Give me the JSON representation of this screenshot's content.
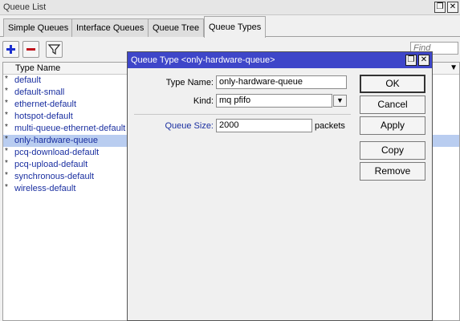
{
  "window": {
    "title": "Queue List"
  },
  "tabs": [
    {
      "label": "Simple Queues"
    },
    {
      "label": "Interface Queues"
    },
    {
      "label": "Queue Tree"
    },
    {
      "label": "Queue Types"
    }
  ],
  "toolbar": {
    "add_icon": "plus-icon",
    "remove_icon": "minus-icon",
    "filter_icon": "filter-icon",
    "find_placeholder": "Find"
  },
  "list": {
    "column_header": "Type Name",
    "rows": [
      {
        "mark": "*",
        "name": "default"
      },
      {
        "mark": "*",
        "name": "default-small"
      },
      {
        "mark": "*",
        "name": "ethernet-default"
      },
      {
        "mark": "*",
        "name": "hotspot-default"
      },
      {
        "mark": "*",
        "name": "multi-queue-ethernet-default"
      },
      {
        "mark": "*",
        "name": "only-hardware-queue"
      },
      {
        "mark": "*",
        "name": "pcq-download-default"
      },
      {
        "mark": "*",
        "name": "pcq-upload-default"
      },
      {
        "mark": "*",
        "name": "synchronous-default"
      },
      {
        "mark": "*",
        "name": "wireless-default"
      }
    ]
  },
  "dialog": {
    "title": "Queue Type <only-hardware-queue>",
    "type_name_label": "Type Name:",
    "type_name_value": "only-hardware-queue",
    "kind_label": "Kind:",
    "kind_value": "mq pfifo",
    "queue_size_label": "Queue Size:",
    "queue_size_value": "2000",
    "queue_size_unit": "packets",
    "buttons": {
      "ok": "OK",
      "cancel": "Cancel",
      "apply": "Apply",
      "copy": "Copy",
      "remove": "Remove"
    }
  },
  "colors": {
    "dialog_title_bg": "#3e46c9",
    "selected_row_bg": "#b9cdf0",
    "link_text": "#1a2fa0",
    "add_icon": "#1b2fd0",
    "remove_icon": "#c0141d"
  }
}
